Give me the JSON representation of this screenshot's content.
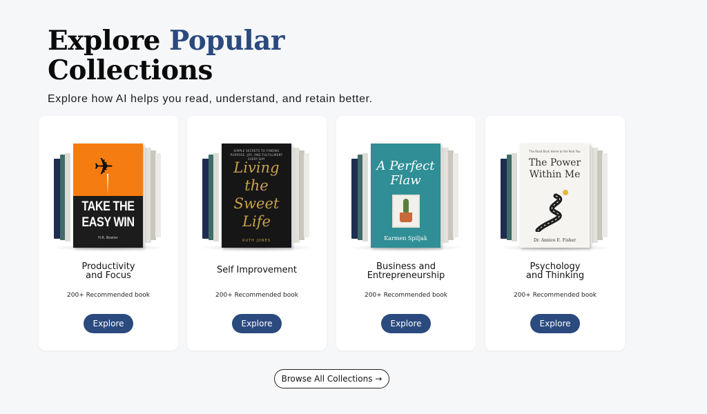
{
  "header": {
    "title_part1": "Explore",
    "title_accent": "Popular",
    "title_part2": "Collections",
    "subtitle": "Explore how AI helps you read, understand, and retain better."
  },
  "colors": {
    "accent": "#2b4a7e",
    "background": "#f6f7f9",
    "card": "#ffffff"
  },
  "collections": [
    {
      "title_line1": "Productivity",
      "title_line2": "and Focus",
      "count": "200+ Recommended book",
      "button": "Explore",
      "book": {
        "title_line1": "TAKE THE",
        "title_line2": "EASY WIN",
        "author": "H.R. Bowler",
        "icon": "airplane-icon"
      }
    },
    {
      "title_line1": "Self Improvement",
      "title_line2": "",
      "count": "200+ Recommended book",
      "button": "Explore",
      "book": {
        "tagline": "SIMPLE SECRETS TO FINDING PURPOSE, JOY, AND FULFILLMENT EVERY DAY",
        "title_line1": "Living",
        "title_line2": "the",
        "title_line3": "Sweet",
        "title_line4": "Life",
        "author": "RUTH JONES"
      }
    },
    {
      "title_line1": "Business and",
      "title_line2": "Entrepreneurship",
      "count": "200+ Recommended book",
      "button": "Explore",
      "book": {
        "title_line1": "A Perfect",
        "title_line2": "Flaw",
        "author": "Karmen Spiljak"
      }
    },
    {
      "title_line1": "Psychology",
      "title_line2": "and Thinking",
      "count": "200+ Recommended book",
      "button": "Explore",
      "book": {
        "tagline": "The Road Back Home to the Real You",
        "title_line1": "The Power",
        "title_line2": "Within Me",
        "author": "Dr. Annice E. Fisher"
      }
    }
  ],
  "browse_all": "Browse All Collections →"
}
